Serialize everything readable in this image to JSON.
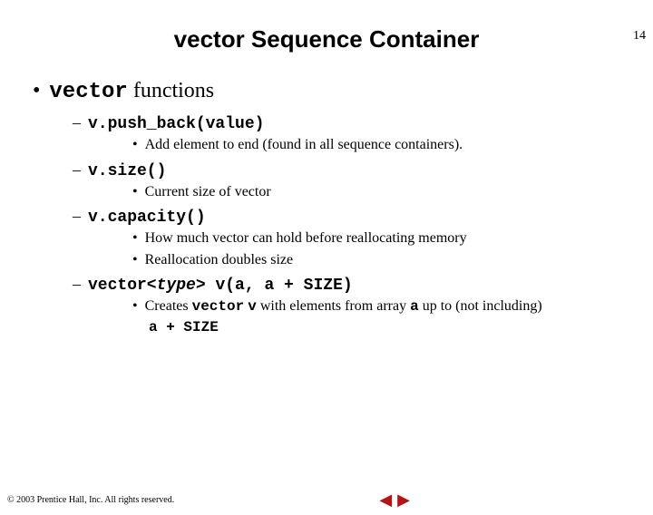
{
  "page_number": "14",
  "title": "vector Sequence Container",
  "l1": {
    "bullet": "•",
    "code": "vector",
    "rest": " functions"
  },
  "items": [
    {
      "dash": "–",
      "code": "v.push_back(value)",
      "subs": [
        {
          "bullet": "•",
          "text": "Add element to end (found in all sequence  containers)."
        }
      ]
    },
    {
      "dash": "–",
      "code": "v.size()",
      "subs": [
        {
          "bullet": "•",
          "text": "Current size of vector"
        }
      ]
    },
    {
      "dash": "–",
      "code": "v.capacity()",
      "subs": [
        {
          "bullet": "•",
          "text": "How much vector can hold before reallocating  memory"
        },
        {
          "bullet": "•",
          "text": "Reallocation doubles size"
        }
      ]
    },
    {
      "dash": "–",
      "code_pre": "vector<",
      "code_type": "type",
      "code_post": "> v(a, a + SIZE)",
      "subs": [
        {
          "bullet": "•",
          "pre": "Creates ",
          "m1": "vector",
          "mid1": " ",
          "m2": "v",
          "mid2": " with elements from array ",
          "m3": "a",
          "mid3": " up to (not including)",
          "wrap": "a + SIZE"
        }
      ]
    }
  ],
  "nav": {
    "prev": "◀",
    "next": "▶"
  },
  "copyright": "© 2003 Prentice Hall, Inc.  All rights reserved."
}
